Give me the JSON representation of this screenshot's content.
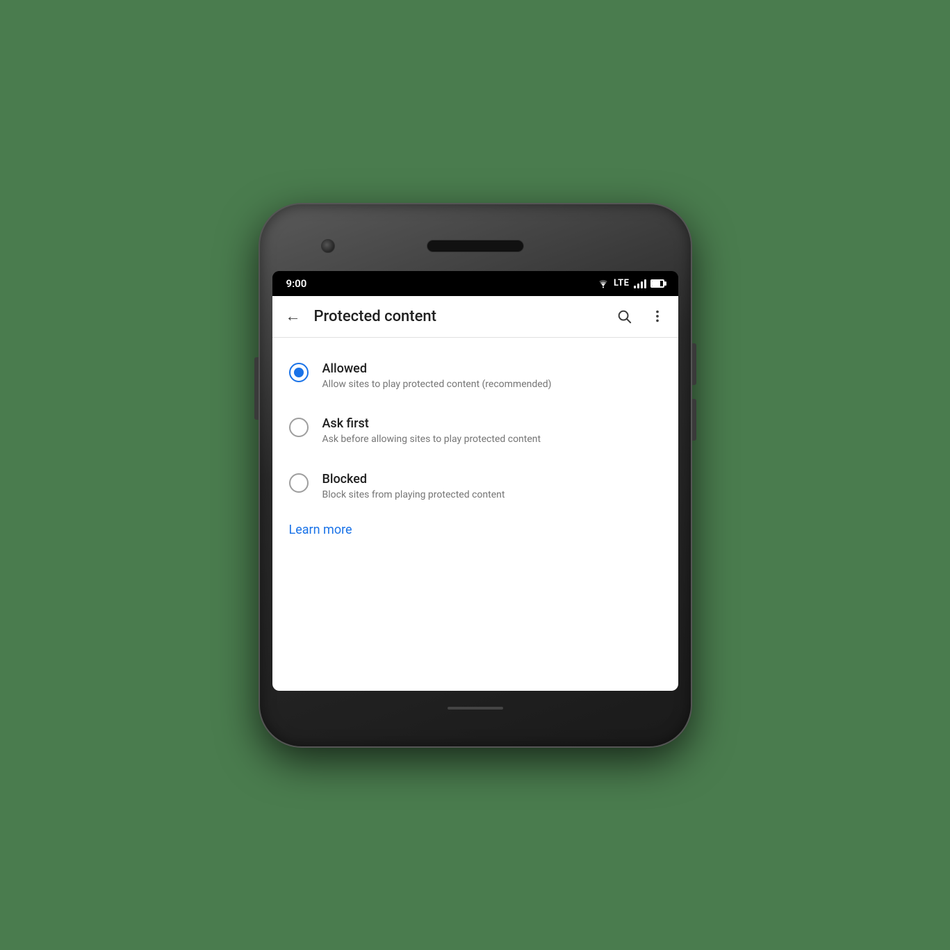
{
  "statusBar": {
    "time": "9:00",
    "lte": "LTE"
  },
  "toolbar": {
    "title": "Protected content",
    "backLabel": "←"
  },
  "options": [
    {
      "id": "allowed",
      "label": "Allowed",
      "description": "Allow sites to play protected content (recommended)",
      "selected": true
    },
    {
      "id": "ask-first",
      "label": "Ask first",
      "description": "Ask before allowing sites to play protected content",
      "selected": false
    },
    {
      "id": "blocked",
      "label": "Blocked",
      "description": "Block sites from playing protected content",
      "selected": false
    }
  ],
  "learnMore": {
    "label": "Learn more"
  }
}
